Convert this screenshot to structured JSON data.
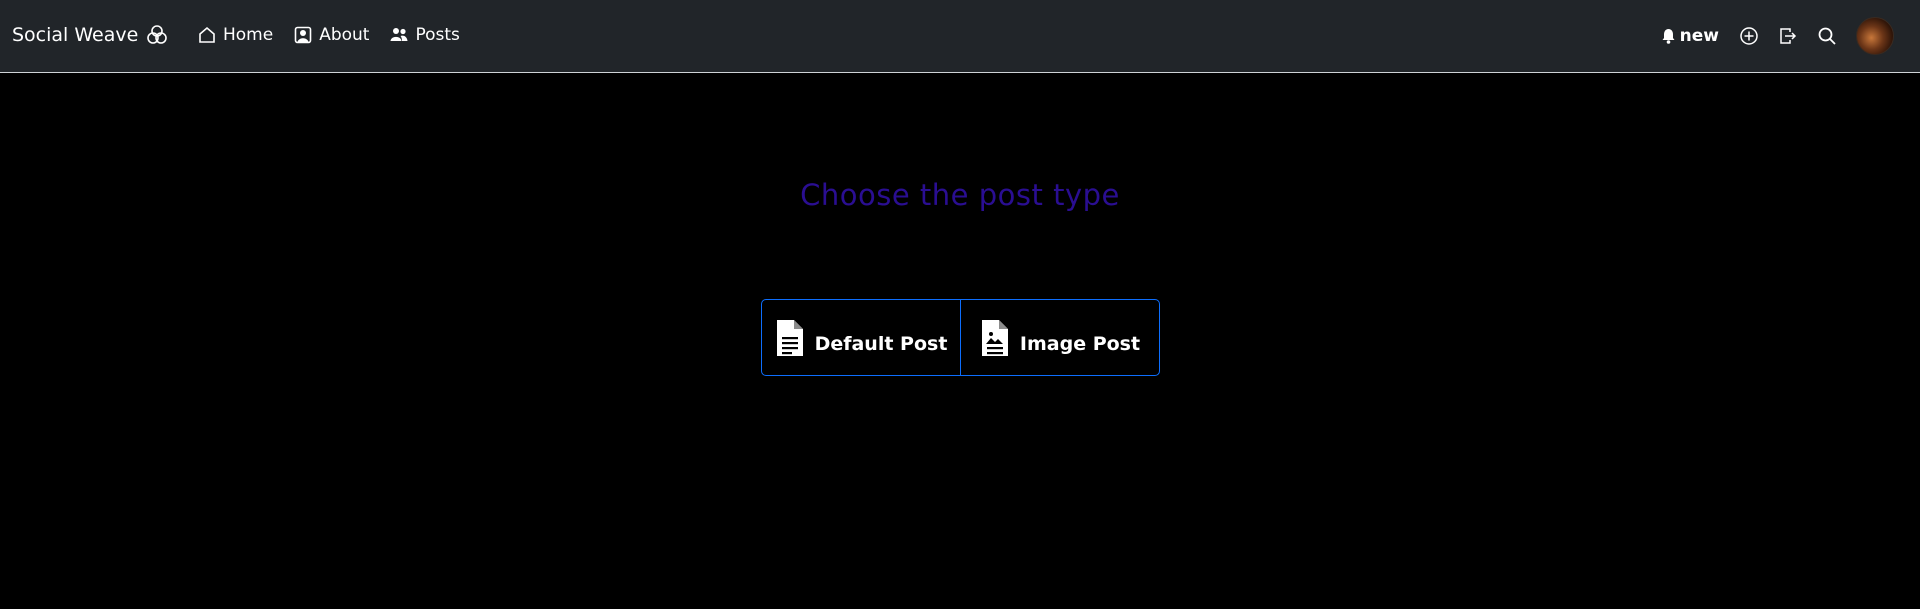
{
  "navbar": {
    "brand": "Social Weave",
    "links": [
      {
        "label": "Home",
        "icon": "house-icon"
      },
      {
        "label": "About",
        "icon": "person-badge-icon"
      },
      {
        "label": "Posts",
        "icon": "people-icon"
      }
    ],
    "notifications_label": "new",
    "right_icons": [
      "plus-circle-icon",
      "box-arrow-in-icon",
      "search-icon"
    ]
  },
  "main": {
    "heading": "Choose the post type",
    "options": [
      {
        "label": "Default Post",
        "icon": "document-text-icon"
      },
      {
        "label": "Image Post",
        "icon": "document-image-icon"
      }
    ]
  },
  "colors": {
    "navbar_bg": "#212529",
    "heading": "#2a0e92",
    "accent_border": "#0d6efd",
    "page_bg": "#000000"
  }
}
